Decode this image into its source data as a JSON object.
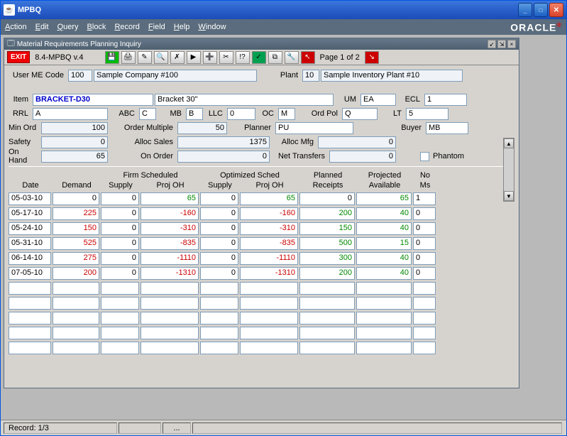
{
  "window": {
    "title": "MPBQ"
  },
  "menu": {
    "action": "Action",
    "edit": "Edit",
    "query": "Query",
    "block": "Block",
    "record": "Record",
    "field": "Field",
    "help": "Help",
    "window": "Window"
  },
  "brand": "ORACLE",
  "inner": {
    "title": "Material Requirements Planning Inquiry"
  },
  "toolbar": {
    "exit": "EXIT",
    "version": "8.4-MPBQ v.4",
    "page": "Page 1 of 2"
  },
  "header": {
    "user_me_label": "User ME Code",
    "user_me": "100",
    "company": "Sample Company #100",
    "plant_label": "Plant",
    "plant": "10",
    "plant_desc": "Sample Inventory Plant #10"
  },
  "item": {
    "item_label": "Item",
    "item": "BRACKET-D30",
    "desc": "Bracket 30\"",
    "um_label": "UM",
    "um": "EA",
    "ecl_label": "ECL",
    "ecl": "1",
    "rrl_label": "RRL",
    "rrl": "A",
    "abc_label": "ABC",
    "abc": "C",
    "mb_label": "MB",
    "mb": "B",
    "llc_label": "LLC",
    "llc": "0",
    "oc_label": "OC",
    "oc": "M",
    "ordpol_label": "Ord Pol",
    "ordpol": "Q",
    "lt_label": "LT",
    "lt": "5",
    "minord_label": "Min Ord",
    "minord": "100",
    "ordmult_label": "Order Multiple",
    "ordmult": "50",
    "planner_label": "Planner",
    "planner": "PU",
    "buyer_label": "Buyer",
    "buyer": "MB",
    "safety_label": "Safety",
    "safety": "0",
    "allocsales_label": "Alloc Sales",
    "allocsales": "1375",
    "allocmfg_label": "Alloc Mfg",
    "allocmfg": "0",
    "phantom_label": "Phantom",
    "onhand_label": "On Hand",
    "onhand": "65",
    "onorder_label": "On Order",
    "onorder": "0",
    "nettrans_label": "Net Transfers",
    "nettrans": "0"
  },
  "grid": {
    "head": {
      "date": "Date",
      "demand": "Demand",
      "firm": "Firm Scheduled",
      "supply": "Supply",
      "projoh": "Proj OH",
      "opt": "Optimized Sched",
      "planned": "Planned",
      "receipts": "Receipts",
      "projected": "Projected",
      "available": "Available",
      "no": "No",
      "ms": "Ms"
    },
    "rows": [
      {
        "date": "05-03-10",
        "demand": "0",
        "fsupply": "0",
        "fproj": "65",
        "fproj_cls": "pos",
        "osupply": "0",
        "oproj": "65",
        "oproj_cls": "pos",
        "rec": "0",
        "rec_cls": "",
        "avail": "65",
        "avail_cls": "pos",
        "nm": "1"
      },
      {
        "date": "05-17-10",
        "demand": "225",
        "demand_cls": "neg",
        "fsupply": "0",
        "fproj": "-160",
        "fproj_cls": "neg",
        "osupply": "0",
        "oproj": "-160",
        "oproj_cls": "neg",
        "rec": "200",
        "rec_cls": "pos",
        "avail": "40",
        "avail_cls": "pos",
        "nm": "0"
      },
      {
        "date": "05-24-10",
        "demand": "150",
        "demand_cls": "neg",
        "fsupply": "0",
        "fproj": "-310",
        "fproj_cls": "neg",
        "osupply": "0",
        "oproj": "-310",
        "oproj_cls": "neg",
        "rec": "150",
        "rec_cls": "pos",
        "avail": "40",
        "avail_cls": "pos",
        "nm": "0"
      },
      {
        "date": "05-31-10",
        "demand": "525",
        "demand_cls": "neg",
        "fsupply": "0",
        "fproj": "-835",
        "fproj_cls": "neg",
        "osupply": "0",
        "oproj": "-835",
        "oproj_cls": "neg",
        "rec": "500",
        "rec_cls": "pos",
        "avail": "15",
        "avail_cls": "pos",
        "nm": "0"
      },
      {
        "date": "06-14-10",
        "demand": "275",
        "demand_cls": "neg",
        "fsupply": "0",
        "fproj": "-1110",
        "fproj_cls": "neg",
        "osupply": "0",
        "oproj": "-1110",
        "oproj_cls": "neg",
        "rec": "300",
        "rec_cls": "pos",
        "avail": "40",
        "avail_cls": "pos",
        "nm": "0"
      },
      {
        "date": "07-05-10",
        "demand": "200",
        "demand_cls": "neg",
        "fsupply": "0",
        "fproj": "-1310",
        "fproj_cls": "neg",
        "osupply": "0",
        "oproj": "-1310",
        "oproj_cls": "neg",
        "rec": "200",
        "rec_cls": "pos",
        "avail": "40",
        "avail_cls": "pos",
        "nm": "0"
      },
      {
        "date": "",
        "demand": "",
        "fsupply": "",
        "fproj": "",
        "osupply": "",
        "oproj": "",
        "rec": "",
        "avail": "",
        "nm": ""
      },
      {
        "date": "",
        "demand": "",
        "fsupply": "",
        "fproj": "",
        "osupply": "",
        "oproj": "",
        "rec": "",
        "avail": "",
        "nm": ""
      },
      {
        "date": "",
        "demand": "",
        "fsupply": "",
        "fproj": "",
        "osupply": "",
        "oproj": "",
        "rec": "",
        "avail": "",
        "nm": ""
      },
      {
        "date": "",
        "demand": "",
        "fsupply": "",
        "fproj": "",
        "osupply": "",
        "oproj": "",
        "rec": "",
        "avail": "",
        "nm": ""
      },
      {
        "date": "",
        "demand": "",
        "fsupply": "",
        "fproj": "",
        "osupply": "",
        "oproj": "",
        "rec": "",
        "avail": "",
        "nm": ""
      }
    ]
  },
  "status": {
    "record": "Record: 1/3",
    "ellipsis": "..."
  }
}
